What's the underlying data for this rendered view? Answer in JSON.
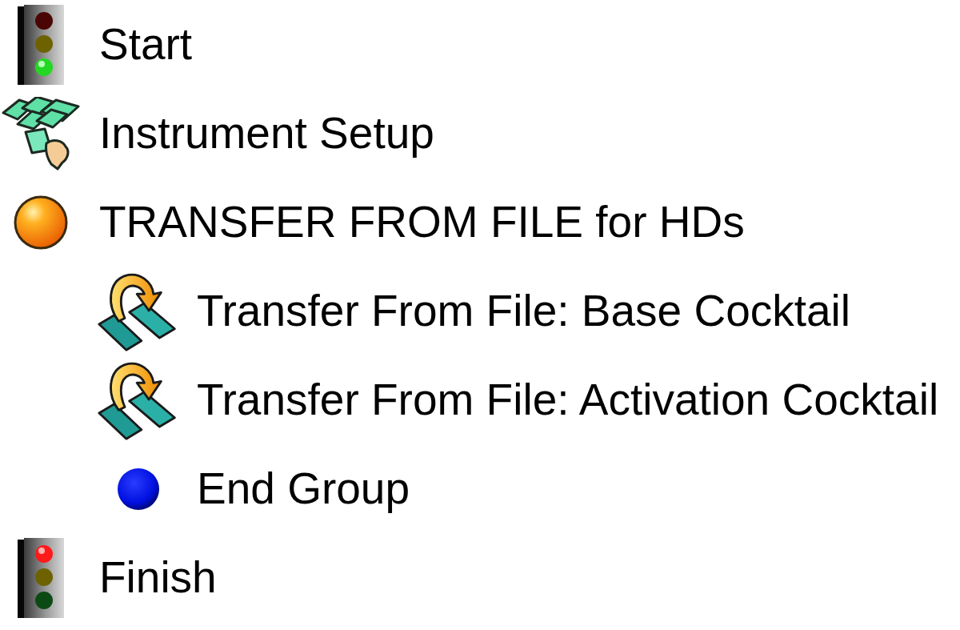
{
  "protocol_tree": [
    {
      "kind": "start",
      "label": "Start"
    },
    {
      "kind": "instrument_setup",
      "label": "Instrument Setup"
    },
    {
      "kind": "group",
      "label": "TRANSFER FROM FILE for HDs",
      "children": [
        {
          "kind": "transfer",
          "label": "Transfer From File: Base Cocktail"
        },
        {
          "kind": "transfer",
          "label": "Transfer From File: Activation Cocktail"
        },
        {
          "kind": "end_group",
          "label": "End Group"
        }
      ]
    },
    {
      "kind": "finish",
      "label": "Finish"
    }
  ]
}
